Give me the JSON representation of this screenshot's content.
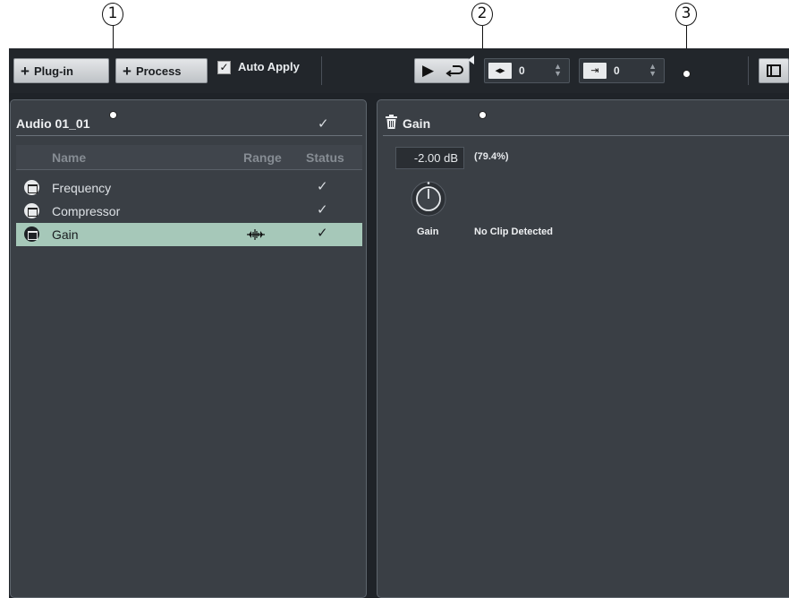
{
  "callouts": [
    "1",
    "2",
    "3"
  ],
  "toolbar": {
    "plugin_label": "Plug-in",
    "process_label": "Process",
    "plus": "+",
    "auto_apply_label": "Auto Apply",
    "auto_apply_checked": true,
    "check_glyph": "✓",
    "play_icon": "play-icon",
    "loop_icon": "loop-icon",
    "pre_roll_value": "0",
    "post_roll_value": "0",
    "spin_arrows": "⌃⌄"
  },
  "clip_panel": {
    "title": "Audio 01_01",
    "status_check": "✓",
    "columns": {
      "name": "Name",
      "range": "Range",
      "status": "Status"
    },
    "processors": [
      {
        "name": "Frequency",
        "range": "",
        "status": "✓",
        "selected": false
      },
      {
        "name": "Compressor",
        "range": "",
        "status": "✓",
        "selected": false
      },
      {
        "name": "Gain",
        "range": "range-icon",
        "status": "✓",
        "selected": true
      }
    ]
  },
  "editor_panel": {
    "title": "Gain",
    "gain_value": "-2.00 dB",
    "gain_percent": "(79.4%)",
    "knob_label": "Gain",
    "clip_status": "No Clip Detected"
  },
  "colors": {
    "toolbar_bg": "#22262b",
    "panel_bg": "#3a3f45",
    "selected_row": "#a6c8b9"
  }
}
